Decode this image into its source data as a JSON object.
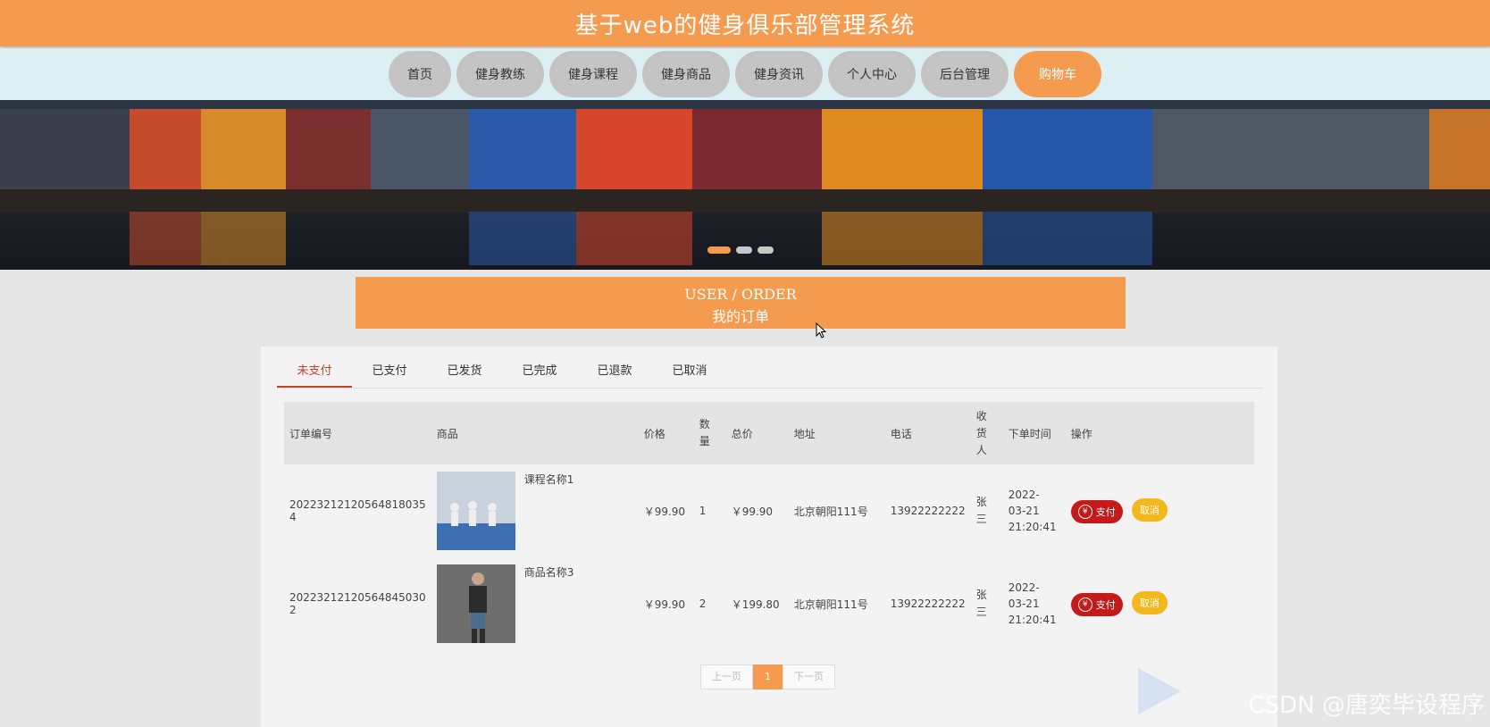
{
  "header": {
    "title": "基于web的健身俱乐部管理系统"
  },
  "nav": {
    "items": [
      "首页",
      "健身教练",
      "健身课程",
      "健身商品",
      "健身资讯",
      "个人中心",
      "后台管理",
      "购物车"
    ],
    "active_index": 7
  },
  "banner": {
    "slide_count": 3,
    "active_slide": 1
  },
  "order_banner": {
    "en": "USER / ORDER",
    "cn": "我的订单"
  },
  "tabs": [
    "未支付",
    "已支付",
    "已发货",
    "已完成",
    "已退款",
    "已取消"
  ],
  "table": {
    "headers": [
      "订单编号",
      "商品",
      "价格",
      "数量",
      "总价",
      "地址",
      "电话",
      "收货人",
      "下单时间",
      "操作"
    ],
    "rows": [
      {
        "order_no": "20223212120564818035​4",
        "product": "课程名称1",
        "price": "￥99.90",
        "qty": "1",
        "total": "￥99.90",
        "address": "北京朝阳111号",
        "phone": "13922222222",
        "receiver": "张三",
        "time": "2022-03-21 21:20:41"
      },
      {
        "order_no": "20223212120564845030​2",
        "product": "商品名称3",
        "price": "￥99.90",
        "qty": "2",
        "total": "￥199.80",
        "address": "北京朝阳111号",
        "phone": "13922222222",
        "receiver": "张三",
        "time": "2022-03-21 21:20:41"
      }
    ],
    "pay_label": "支付",
    "cancel_label": "取消"
  },
  "pager": {
    "prev": "上一页",
    "current": "1",
    "next": "下一页"
  },
  "watermark": "CSDN @唐奕毕设程序",
  "colors": {
    "accent": "#f59b50",
    "pay": "#c41a1a",
    "cancel": "#f3b81c",
    "tab_active": "#c7432c"
  }
}
